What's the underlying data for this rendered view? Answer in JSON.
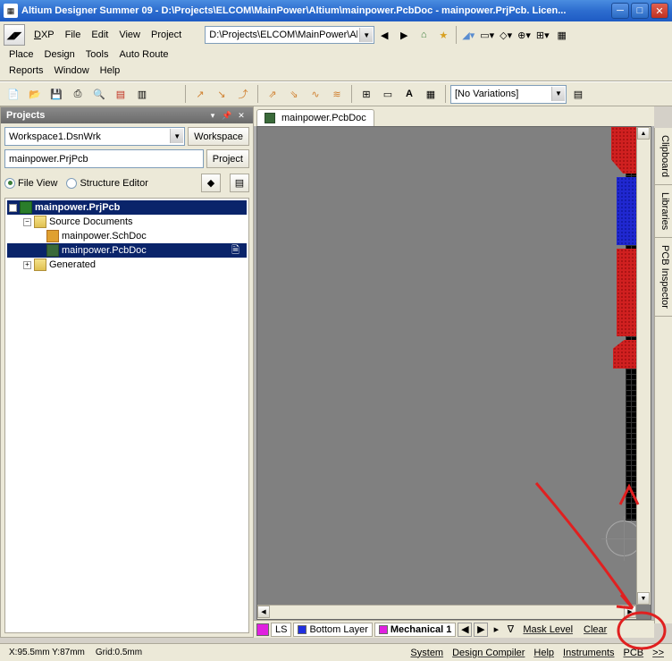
{
  "title": "Altium Designer Summer 09 - D:\\Projects\\ELCOM\\MainPower\\Altium\\mainpower.PcbDoc - mainpower.PrjPcb. Licen...",
  "menu": {
    "dxp": "DXP",
    "file": "File",
    "edit": "Edit",
    "view": "View",
    "project": "Project",
    "place": "Place",
    "design": "Design",
    "tools": "Tools",
    "auto_route": "Auto Route",
    "reports": "Reports",
    "window": "Window",
    "help": "Help"
  },
  "path_box": "D:\\Projects\\ELCOM\\MainPower\\Altium\\",
  "toolbar2": {
    "variations": "[No Variations]"
  },
  "panel": {
    "title": "Projects",
    "workspace_value": "Workspace1.DsnWrk",
    "workspace_btn": "Workspace",
    "project_value": "mainpower.PrjPcb",
    "project_btn": "Project",
    "file_view": "File View",
    "structure_editor": "Structure Editor"
  },
  "tree": {
    "root": "mainpower.PrjPcb",
    "src": "Source Documents",
    "sch": "mainpower.SchDoc",
    "pcb": "mainpower.PcbDoc",
    "gen": "Generated"
  },
  "doc_tab": "mainpower.PcbDoc",
  "layers": {
    "ls": "LS",
    "bottom": "Bottom Layer",
    "mech": "Mechanical 1",
    "mask": "Mask Level",
    "clear": "Clear"
  },
  "side_tabs": {
    "clipboard": "Clipboard",
    "libraries": "Libraries",
    "pcb_inspector": "PCB Inspector"
  },
  "status": {
    "coords": "X:95.5mm Y:87mm",
    "grid": "Grid:0.5mm",
    "system": "System",
    "design_compiler": "Design Compiler",
    "help": "Help",
    "instruments": "Instruments",
    "pcb": "PCB",
    "more": ">>"
  }
}
